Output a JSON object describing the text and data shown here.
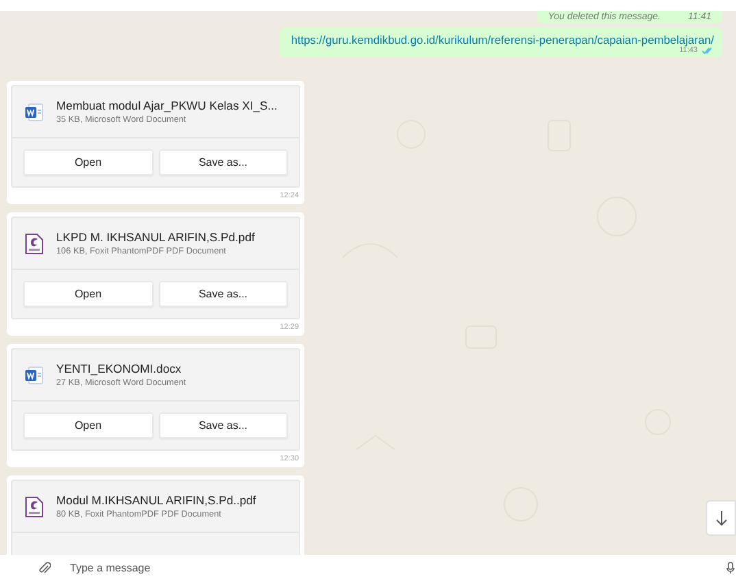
{
  "deleted_message": {
    "text": "You deleted this message.",
    "time": "11:41"
  },
  "link_message": {
    "url": "https://guru.kemdikbud.go.id/kurikulum/referensi-penerapan/capaian-pembelajaran/",
    "time": "11:43",
    "read": true
  },
  "files": [
    {
      "kind": "word",
      "name": "Membuat modul Ajar_PKWU Kelas XI_S...",
      "meta": "35 KB, Microsoft Word Document",
      "buttons": [
        "Open",
        "Save as..."
      ],
      "time": "12:24"
    },
    {
      "kind": "pdf",
      "name": "LKPD M. IKHSANUL ARIFIN,S.Pd.pdf",
      "meta": "106 KB, Foxit PhantomPDF PDF Document",
      "buttons": [
        "Open",
        "Save as..."
      ],
      "time": "12:29"
    },
    {
      "kind": "word",
      "name": "YENTI_EKONOMI.docx",
      "meta": "27 KB, Microsoft Word Document",
      "buttons": [
        "Open",
        "Save as..."
      ],
      "time": "12:30"
    },
    {
      "kind": "pdf",
      "name": "Modul M.IKHSANUL ARIFIN,S.Pd..pdf",
      "meta": "80 KB, Foxit PhantomPDF PDF Document"
    }
  ],
  "composer": {
    "placeholder": "Type a message"
  }
}
